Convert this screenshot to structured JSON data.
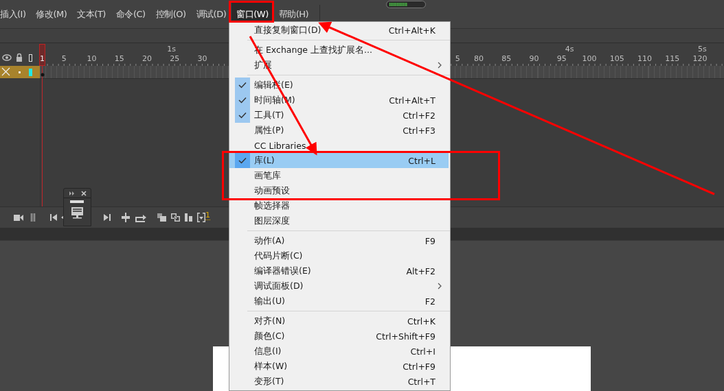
{
  "menubar": {
    "items": [
      {
        "label": "插入(I)",
        "selected": false
      },
      {
        "label": "修改(M)",
        "selected": false
      },
      {
        "label": "文本(T)",
        "selected": false
      },
      {
        "label": "命令(C)",
        "selected": false
      },
      {
        "label": "控制(O)",
        "selected": false
      },
      {
        "label": "调试(D)",
        "selected": false
      },
      {
        "label": "窗口(W)",
        "selected": true
      },
      {
        "label": "帮助(H)",
        "selected": false
      }
    ]
  },
  "timeline": {
    "playhead_label": "1",
    "ruler": {
      "left_labels": [
        "5",
        "10",
        "15",
        "20",
        "25",
        "30"
      ],
      "right_labels": [
        "5",
        "80",
        "85",
        "90",
        "95",
        "100",
        "105",
        "110",
        "115",
        "120"
      ],
      "left_seconds": [
        "1s"
      ],
      "right_seconds": [
        "4s",
        "5s"
      ]
    },
    "layers": [
      {
        "selected": true
      }
    ],
    "toolbar": {
      "frame_number": "1"
    }
  },
  "window_menu": {
    "items": [
      {
        "kind": "item",
        "label": "直接复制窗口(D)",
        "shortcut": "Ctrl+Alt+K",
        "checked": false,
        "selected": false,
        "submenu": false
      },
      {
        "kind": "separator"
      },
      {
        "kind": "item",
        "label": "在 Exchange 上查找扩展名...",
        "checked": false,
        "selected": false,
        "submenu": false
      },
      {
        "kind": "item",
        "label": "扩展",
        "checked": false,
        "selected": false,
        "submenu": true
      },
      {
        "kind": "separator"
      },
      {
        "kind": "item",
        "label": "编辑栏(E)",
        "checked": true,
        "selected": false,
        "submenu": false
      },
      {
        "kind": "item",
        "label": "时间轴(M)",
        "shortcut": "Ctrl+Alt+T",
        "checked": true,
        "selected": false,
        "submenu": false
      },
      {
        "kind": "item",
        "label": "工具(T)",
        "shortcut": "Ctrl+F2",
        "checked": true,
        "selected": false,
        "submenu": false
      },
      {
        "kind": "item",
        "label": "属性(P)",
        "shortcut": "Ctrl+F3",
        "checked": false,
        "selected": false,
        "submenu": false
      },
      {
        "kind": "item",
        "label": "CC Libraries",
        "checked": false,
        "selected": false,
        "submenu": false
      },
      {
        "kind": "item",
        "label": "库(L)",
        "shortcut": "Ctrl+L",
        "checked": true,
        "selected": true,
        "submenu": false
      },
      {
        "kind": "item",
        "label": "画笔库",
        "checked": false,
        "selected": false,
        "submenu": false
      },
      {
        "kind": "item",
        "label": "动画预设",
        "checked": false,
        "selected": false,
        "submenu": false
      },
      {
        "kind": "item",
        "label": "帧选择器",
        "checked": false,
        "selected": false,
        "submenu": false
      },
      {
        "kind": "item",
        "label": "图层深度",
        "checked": false,
        "selected": false,
        "submenu": false
      },
      {
        "kind": "separator"
      },
      {
        "kind": "item",
        "label": "动作(A)",
        "shortcut": "F9",
        "checked": false,
        "selected": false,
        "submenu": false
      },
      {
        "kind": "item",
        "label": "代码片断(C)",
        "checked": false,
        "selected": false,
        "submenu": false
      },
      {
        "kind": "item",
        "label": "编译器错误(E)",
        "shortcut": "Alt+F2",
        "checked": false,
        "selected": false,
        "submenu": false
      },
      {
        "kind": "item",
        "label": "调试面板(D)",
        "checked": false,
        "selected": false,
        "submenu": true
      },
      {
        "kind": "item",
        "label": "输出(U)",
        "shortcut": "F2",
        "checked": false,
        "selected": false,
        "submenu": false
      },
      {
        "kind": "separator"
      },
      {
        "kind": "item",
        "label": "对齐(N)",
        "shortcut": "Ctrl+K",
        "checked": false,
        "selected": false,
        "submenu": false
      },
      {
        "kind": "item",
        "label": "颜色(C)",
        "shortcut": "Ctrl+Shift+F9",
        "checked": false,
        "selected": false,
        "submenu": false
      },
      {
        "kind": "item",
        "label": "信息(I)",
        "shortcut": "Ctrl+I",
        "checked": false,
        "selected": false,
        "submenu": false
      },
      {
        "kind": "item",
        "label": "样本(W)",
        "shortcut": "Ctrl+F9",
        "checked": false,
        "selected": false,
        "submenu": false
      },
      {
        "kind": "item",
        "label": "变形(T)",
        "shortcut": "Ctrl+T",
        "checked": false,
        "selected": false,
        "submenu": false
      }
    ]
  }
}
